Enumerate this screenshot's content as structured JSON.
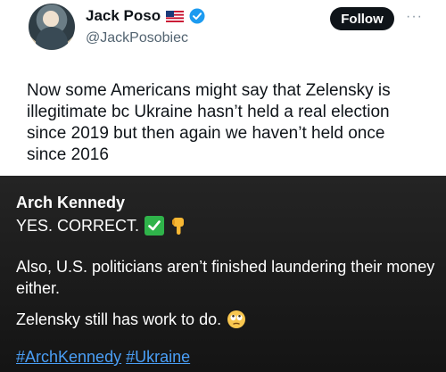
{
  "tweet": {
    "display_name": "Jack Poso",
    "handle": "@JackPosobiec",
    "follow_label": "Follow",
    "more_label": "···",
    "text": "Now some Americans might say that Zelensky is illegitimate bc Ukraine hasn’t held a real election since 2019 but then again we haven’t held once since 2016"
  },
  "post": {
    "author": "Arch Kennedy",
    "line1": "YES. CORRECT.",
    "para2": "Also, U.S. politicians aren’t finished laundering their money either.",
    "para3": "Zelensky still has work to do.",
    "hashtags": [
      "#ArchKennedy",
      "#Ukraine"
    ]
  },
  "icons": {
    "flag": "us-flag-icon",
    "verified": "verified-badge-icon",
    "check": "check-mark-icon",
    "point_down": "pointing-down-icon",
    "eye_roll": "eye-roll-face-icon"
  },
  "colors": {
    "verified": "#1d9bf0",
    "follow_bg": "#0f1419",
    "hashtag": "#4a9ef5",
    "check_bg": "#2fb34a"
  }
}
